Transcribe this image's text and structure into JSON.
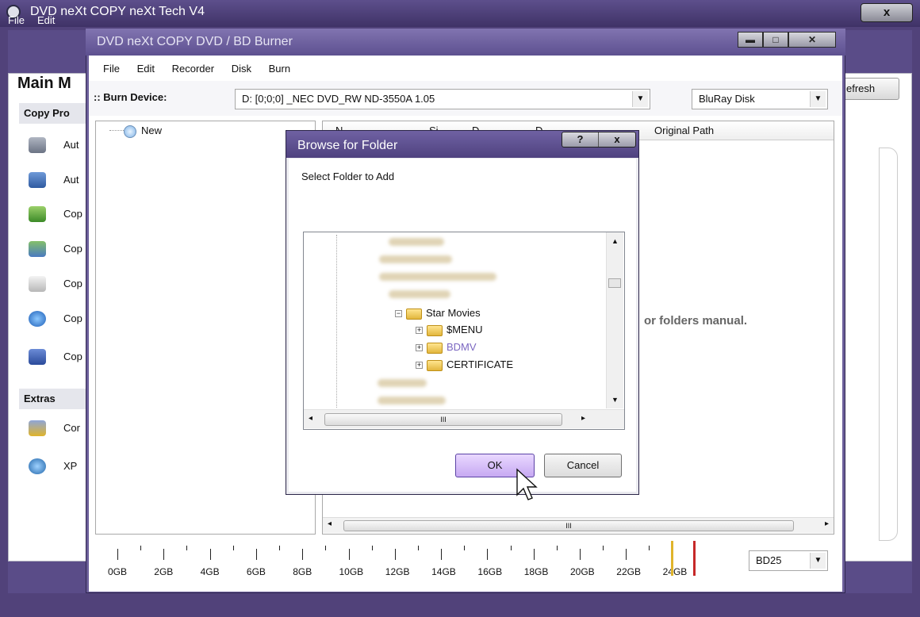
{
  "outer": {
    "title": "DVD neXt COPY neXt Tech V4",
    "close": "x",
    "menu": [
      "File",
      "Edit"
    ],
    "sidebar_title": "Main M",
    "refresh": "efresh",
    "sections": {
      "copy": "Copy Pro",
      "extras": "Extras"
    },
    "copy_items": [
      "Aut",
      "Aut",
      "Cop",
      "Cop",
      "Cop",
      "Cop",
      "Cop"
    ],
    "extra_items": [
      "Cor",
      "XP"
    ]
  },
  "burner": {
    "title": "DVD neXt COPY DVD / BD Burner",
    "menu": [
      "File",
      "Edit",
      "Recorder",
      "Disk",
      "Burn"
    ],
    "burn_device_label": ":: Burn Device:",
    "device": "D: [0;0;0] _NEC   DVD_RW ND-3550A  1.05",
    "disc_type": "BluRay Disk",
    "tree_root": "New",
    "columns": [
      "N",
      "Si",
      "D",
      "D",
      "Original Path"
    ],
    "hint": "or folders manual.",
    "scroll_grip": "III",
    "capacity_labels": [
      "0GB",
      "2GB",
      "4GB",
      "6GB",
      "8GB",
      "10GB",
      "12GB",
      "14GB",
      "16GB",
      "18GB",
      "20GB",
      "22GB",
      "24GB"
    ],
    "disc_size": "BD25"
  },
  "dialog": {
    "title": "Browse for Folder",
    "help": "?",
    "close": "x",
    "prompt": "Select Folder to Add",
    "folders": {
      "parent": "Star Movies",
      "children": [
        "$MENU",
        "BDMV",
        "CERTIFICATE"
      ],
      "selected": "BDMV"
    },
    "scroll_grip": "III",
    "ok": "OK",
    "cancel": "Cancel"
  },
  "colors": {
    "frame": "#51427a",
    "title_bar": "#6f61a3",
    "selected_folder": "#7b67c1",
    "marker_yellow": "#e0b42b",
    "marker_red": "#c62828"
  }
}
